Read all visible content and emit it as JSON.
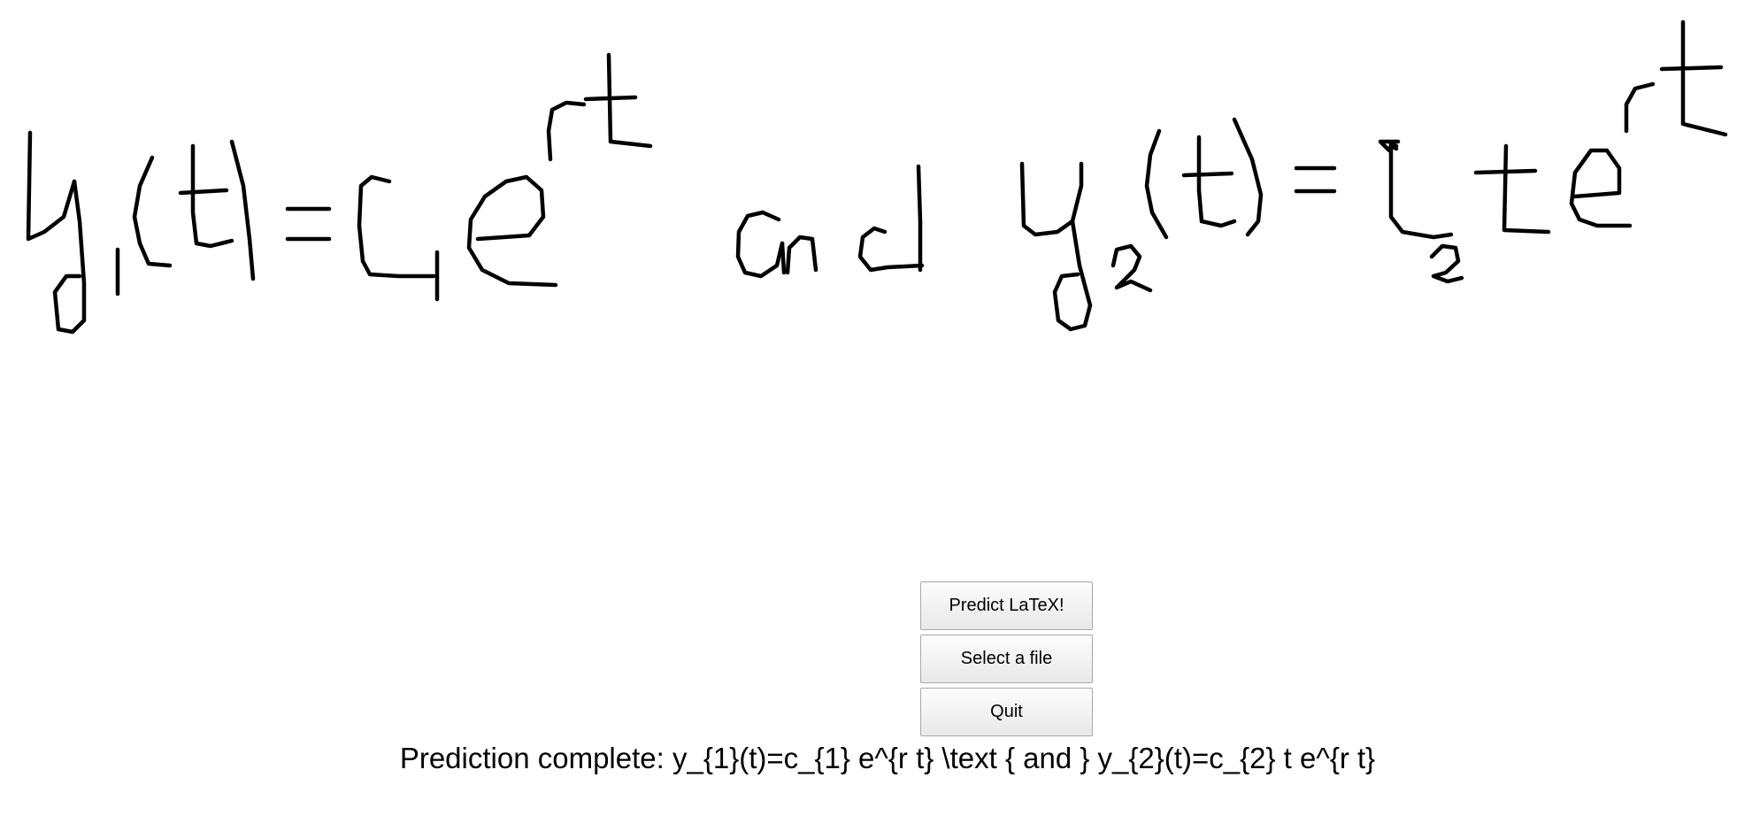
{
  "canvas": {
    "ink_color": "#000000",
    "background": "#ffffff",
    "content": "handwritten equation strokes"
  },
  "buttons": {
    "predict_label": "Predict LaTeX!",
    "select_file_label": "Select a file",
    "quit_label": "Quit"
  },
  "status": {
    "text": "Prediction complete: y_{1}(t)=c_{1} e^{r t} \\text { and } y_{2}(t)=c_{2} t e^{r t}"
  }
}
